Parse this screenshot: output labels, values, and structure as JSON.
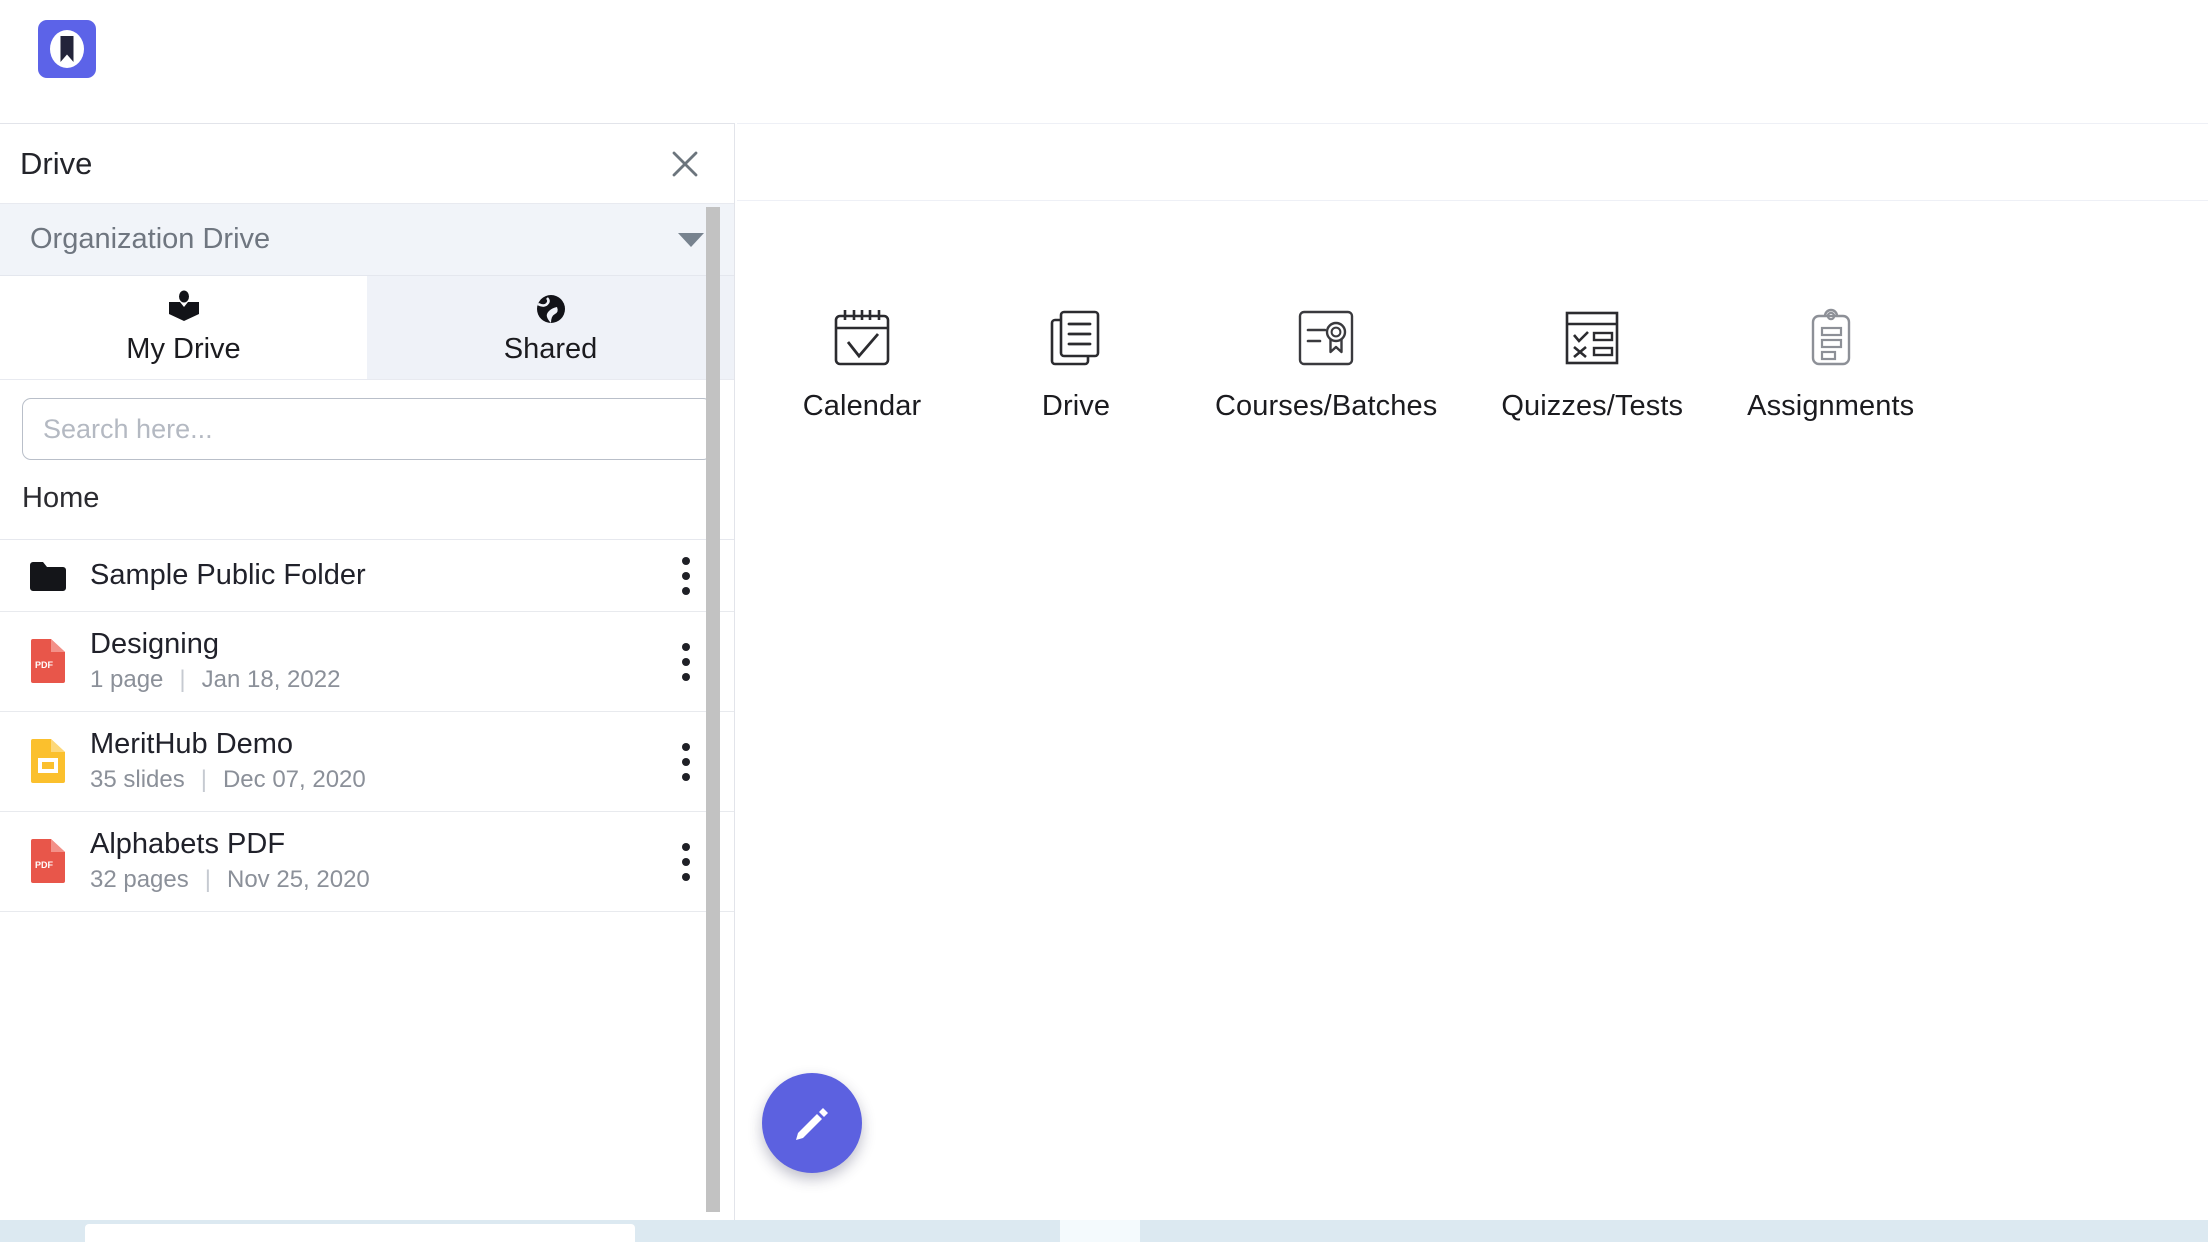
{
  "brand": {
    "logo_icon": "bookmark-logo-icon",
    "logo_color": "#5c63e8"
  },
  "drive_panel": {
    "title": "Drive",
    "close_icon": "close-icon",
    "org_select": {
      "value": "Organization Drive",
      "caret_icon": "chevron-down-icon"
    },
    "tabs": [
      {
        "label": "My Drive",
        "icon": "person-reading-book-icon",
        "active": false
      },
      {
        "label": "Shared",
        "icon": "globe-icon",
        "active": true
      }
    ],
    "search": {
      "placeholder": "Search here...",
      "value": ""
    },
    "breadcrumb": "Home",
    "files": [
      {
        "name": "Sample Public Folder",
        "type": "folder",
        "icon": "folder-icon",
        "count": "",
        "date": "",
        "menu_icon": "kebab-menu-icon"
      },
      {
        "name": "Designing",
        "type": "pdf",
        "icon": "pdf-file-icon",
        "count": "1 page",
        "date": "Jan 18, 2022",
        "menu_icon": "kebab-menu-icon"
      },
      {
        "name": "MeritHub Demo",
        "type": "slides",
        "icon": "slides-file-icon",
        "count": "35 slides",
        "date": "Dec 07, 2020",
        "menu_icon": "kebab-menu-icon"
      },
      {
        "name": "Alphabets PDF",
        "type": "pdf",
        "icon": "pdf-file-icon",
        "count": "32 pages",
        "date": "Nov 25, 2020",
        "menu_icon": "kebab-menu-icon"
      }
    ],
    "scrollbar_color": "#c2c2c2"
  },
  "app_shortcuts": [
    {
      "label": "Calendar",
      "icon": "calendar-check-icon"
    },
    {
      "label": "Drive",
      "icon": "documents-stack-icon"
    },
    {
      "label": "Courses/Batches",
      "icon": "certificate-award-icon"
    },
    {
      "label": "Quizzes/Tests",
      "icon": "quiz-checkbox-icon"
    },
    {
      "label": "Assignments",
      "icon": "clipboard-icon"
    }
  ],
  "fab": {
    "icon": "pencil-edit-icon",
    "color": "#5c61e0",
    "label": ""
  },
  "colors": {
    "accent": "#5c63e8",
    "tab_active_bg": "#eff2f8",
    "org_select_bg": "#f1f4f9",
    "pdf_red": "#e8564a",
    "slides_yellow": "#fbc02d",
    "bottom_strip": "#dce9f1"
  }
}
